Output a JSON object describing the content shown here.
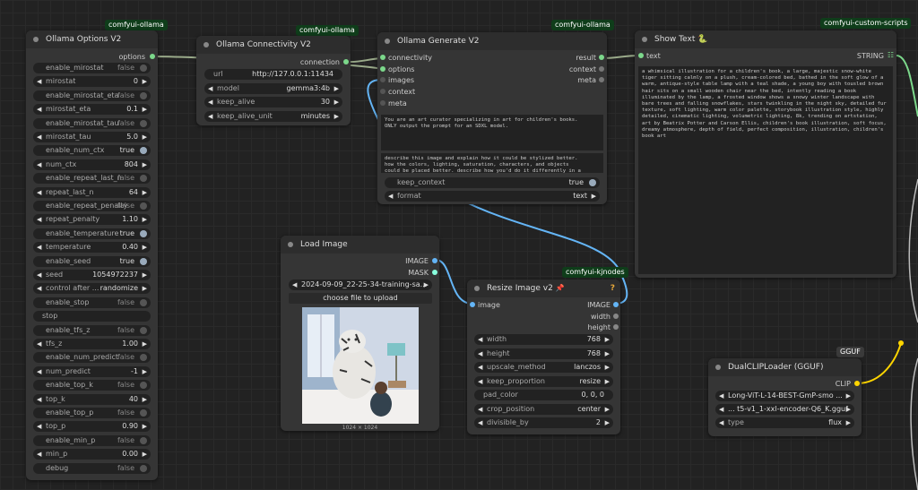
{
  "badges": {
    "ollama_options": "comfyui-ollama",
    "ollama_connectivity": "comfyui-ollama",
    "ollama_generate": "comfyui-ollama",
    "show_text": "comfyui-custom-scripts",
    "resize_image": "comfyui-kjnodes",
    "dualclip": "GGUF"
  },
  "ollama_options": {
    "title": "Ollama Options V2",
    "output_label": "options",
    "widgets": [
      {
        "label": "enable_mirostat",
        "value": "false",
        "kind": "toggle",
        "on": false
      },
      {
        "label": "mirostat",
        "value": "0",
        "kind": "number"
      },
      {
        "label": "enable_mirostat_eta",
        "value": "false",
        "kind": "toggle",
        "on": false
      },
      {
        "label": "mirostat_eta",
        "value": "0.1",
        "kind": "number"
      },
      {
        "label": "enable_mirostat_tau",
        "value": "false",
        "kind": "toggle",
        "on": false
      },
      {
        "label": "mirostat_tau",
        "value": "5.0",
        "kind": "number"
      },
      {
        "label": "enable_num_ctx",
        "value": "true",
        "kind": "toggle",
        "on": true
      },
      {
        "label": "num_ctx",
        "value": "804",
        "kind": "number"
      },
      {
        "label": "enable_repeat_last_n",
        "value": "false",
        "kind": "toggle",
        "on": false
      },
      {
        "label": "repeat_last_n",
        "value": "64",
        "kind": "number"
      },
      {
        "label": "enable_repeat_penalty",
        "value": "false",
        "kind": "toggle",
        "on": false
      },
      {
        "label": "repeat_penalty",
        "value": "1.10",
        "kind": "number"
      },
      {
        "label": "enable_temperature",
        "value": "true",
        "kind": "toggle",
        "on": true
      },
      {
        "label": "temperature",
        "value": "0.40",
        "kind": "number"
      },
      {
        "label": "enable_seed",
        "value": "true",
        "kind": "toggle",
        "on": true
      },
      {
        "label": "seed",
        "value": "1054972237",
        "kind": "number"
      },
      {
        "label": "control after ...",
        "value": "randomize",
        "kind": "number"
      },
      {
        "label": "enable_stop",
        "value": "false",
        "kind": "toggle",
        "on": false
      },
      {
        "label": "stop",
        "value": "",
        "kind": "text"
      },
      {
        "label": "enable_tfs_z",
        "value": "false",
        "kind": "toggle",
        "on": false
      },
      {
        "label": "tfs_z",
        "value": "1.00",
        "kind": "number"
      },
      {
        "label": "enable_num_predict",
        "value": "false",
        "kind": "toggle",
        "on": false
      },
      {
        "label": "num_predict",
        "value": "-1",
        "kind": "number"
      },
      {
        "label": "enable_top_k",
        "value": "false",
        "kind": "toggle",
        "on": false
      },
      {
        "label": "top_k",
        "value": "40",
        "kind": "number"
      },
      {
        "label": "enable_top_p",
        "value": "false",
        "kind": "toggle",
        "on": false
      },
      {
        "label": "top_p",
        "value": "0.90",
        "kind": "number"
      },
      {
        "label": "enable_min_p",
        "value": "false",
        "kind": "toggle",
        "on": false
      },
      {
        "label": "min_p",
        "value": "0.00",
        "kind": "number"
      },
      {
        "label": "debug",
        "value": "false",
        "kind": "toggle",
        "on": false
      }
    ]
  },
  "ollama_connectivity": {
    "title": "Ollama Connectivity V2",
    "output_label": "connection",
    "widgets": [
      {
        "label": "url",
        "value": "http://127.0.0.1:11434",
        "kind": "text"
      },
      {
        "label": "model",
        "value": "gemma3:4b",
        "kind": "number"
      },
      {
        "label": "keep_alive",
        "value": "30",
        "kind": "number"
      },
      {
        "label": "keep_alive_unit",
        "value": "minutes",
        "kind": "number"
      }
    ]
  },
  "ollama_generate": {
    "title": "Ollama Generate V2",
    "inputs": [
      "connectivity",
      "options",
      "images",
      "context",
      "meta"
    ],
    "outputs": [
      "result",
      "context",
      "meta"
    ],
    "system_prompt": "You are an art curator specializing in art for children's books.\nONLY output the prompt for an SDXL model.",
    "user_prompt": "describe this image and explain how it could be stylized better.\nhow the colors, lighting, saturation, characters, and objects\ncould be placed better. describe how you'd do it differently in a",
    "widgets": [
      {
        "label": "keep_context",
        "value": "true",
        "kind": "toggle",
        "on": true
      },
      {
        "label": "format",
        "value": "text",
        "kind": "number"
      }
    ]
  },
  "show_text": {
    "title": "Show Text",
    "title_icon": "snake-icon",
    "input_label": "text",
    "output_label": "STRING",
    "content": "a whimsical illustration for a children's book, a large, majestic snow-white tiger sitting calmly on a plush, cream-colored bed, bathed in the soft glow of a warm, antique-style table lamp with a teal shade, a young boy with tousled brown hair sits on a small wooden chair near the bed, intently reading a book illuminated by the lamp, a frosted window shows a snowy winter landscape with bare trees and falling snowflakes, stars twinkling in the night sky, detailed fur texture, soft lighting, warm color palette, storybook illustration style, highly detailed, cinematic lighting, volumetric lighting, 8k, trending on artstation, art by Beatrix Potter and Carson Ellis, children's book illustration, soft focus, dreamy atmosphere, depth of field, perfect composition, illustration, children's book art"
  },
  "load_image": {
    "title": "Load Image",
    "outputs": [
      "IMAGE",
      "MASK"
    ],
    "image_widget": "2024-09-09_22-25-34-training-sa...",
    "upload_label": "choose file to upload",
    "dimensions": "1024 × 1024"
  },
  "resize_image": {
    "title": "Resize Image v2",
    "title_icon": "pushpin-icon",
    "help_icon": "?",
    "input_label": "image",
    "outputs": [
      "IMAGE",
      "width",
      "height"
    ],
    "widgets": [
      {
        "label": "width",
        "value": "768",
        "kind": "number"
      },
      {
        "label": "height",
        "value": "768",
        "kind": "number"
      },
      {
        "label": "upscale_method",
        "value": "lanczos",
        "kind": "number"
      },
      {
        "label": "keep_proportion",
        "value": "resize",
        "kind": "number"
      },
      {
        "label": "pad_color",
        "value": "0, 0, 0",
        "kind": "text"
      },
      {
        "label": "crop_position",
        "value": "center",
        "kind": "number"
      },
      {
        "label": "divisible_by",
        "value": "2",
        "kind": "number"
      }
    ]
  },
  "dualclip": {
    "title": "DualCLIPLoader (GGUF)",
    "output_label": "CLIP",
    "widgets": [
      {
        "label": "",
        "value": "Long-ViT-L-14-BEST-GmP-smo ...",
        "kind": "combo"
      },
      {
        "label": "",
        "value": "... t5-v1_1-xxl-encoder-Q6_K.gguf",
        "kind": "combo"
      },
      {
        "label": "type",
        "value": "flux",
        "kind": "number"
      }
    ]
  },
  "colors": {
    "canvas": "#222222",
    "node": "#353535",
    "title": "#2d2d2d",
    "wire_options": "#6a8f6a",
    "wire_image": "#64b5f6",
    "wire_clip": "#ffd500",
    "wire_string": "#7cd88b"
  }
}
